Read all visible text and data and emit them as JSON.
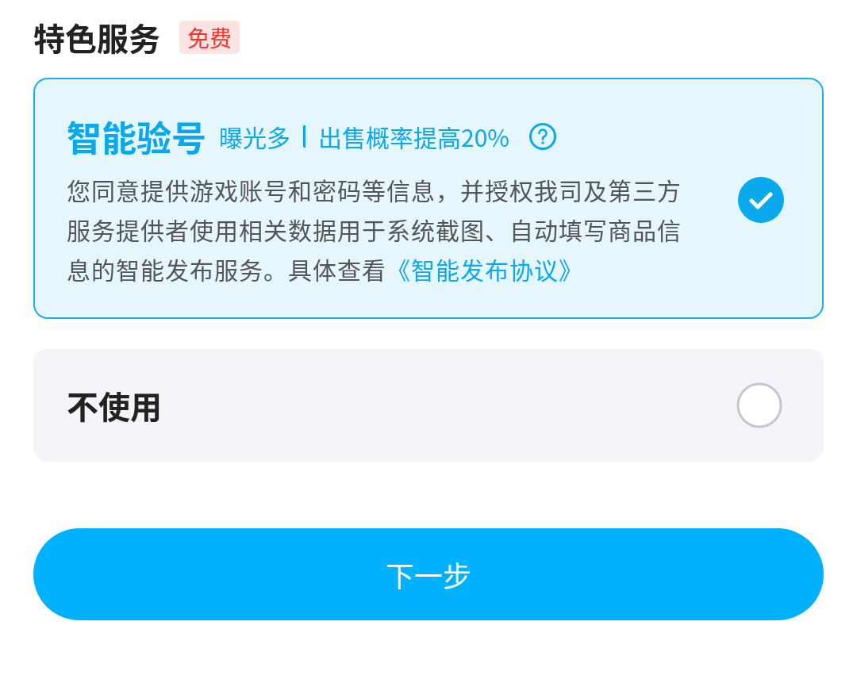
{
  "section": {
    "title": "特色服务",
    "badge": "免费"
  },
  "options": [
    {
      "kind": "detailed",
      "selected": true,
      "title": "智能验号",
      "tags": [
        "曝光多",
        "出售概率提高20%"
      ],
      "description": "您同意提供游戏账号和密码等信息，并授权我司及第三方服务提供者使用相关数据用于系统截图、自动填写商品信息的智能发布服务。具体查看",
      "link": "《智能发布协议》"
    },
    {
      "kind": "simple",
      "selected": false,
      "title": "不使用"
    }
  ],
  "next_button": "下一步"
}
